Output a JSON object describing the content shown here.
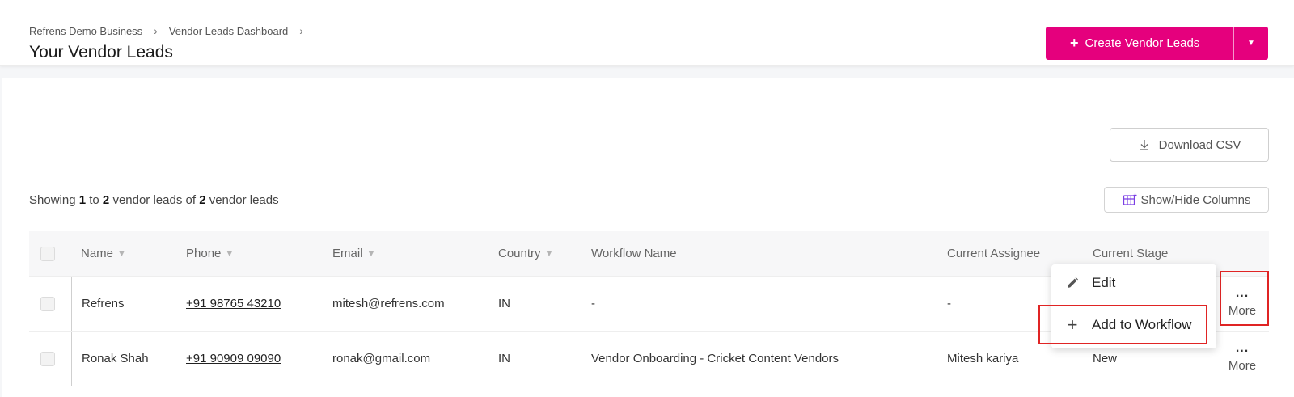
{
  "breadcrumb": [
    "Refrens Demo Business",
    "Vendor Leads Dashboard"
  ],
  "breadcrumb_sep": "›",
  "page_title": "Your Vendor Leads",
  "create_button": {
    "plus": "+",
    "label": "Create Vendor Leads",
    "caret": "▼"
  },
  "download_csv_label": "Download CSV",
  "showing": {
    "prefix": "Showing",
    "from": "1",
    "to_word": "to",
    "to": "2",
    "unit": "vendor leads",
    "of_word": "of",
    "total": "2",
    "suffix": "vendor leads"
  },
  "show_hide_label": "Show/Hide Columns",
  "columns": {
    "name": "Name",
    "phone": "Phone",
    "email": "Email",
    "country": "Country",
    "workflow": "Workflow Name",
    "assignee": "Current Assignee",
    "stage": "Current Stage"
  },
  "filter_glyph": "▼",
  "rows": [
    {
      "name": "Refrens",
      "phone": "+91 98765 43210",
      "email": "mitesh@refrens.com",
      "country": "IN",
      "workflow": "-",
      "assignee": "-",
      "stage": "",
      "more_dots": "...",
      "more_label": "More"
    },
    {
      "name": "Ronak Shah",
      "phone": "+91 90909 09090",
      "email": "ronak@gmail.com",
      "country": "IN",
      "workflow": "Vendor Onboarding - Cricket Content Vendors",
      "assignee": "Mitesh kariya",
      "stage": "New",
      "more_dots": "...",
      "more_label": "More"
    }
  ],
  "menu": {
    "edit_label": "Edit",
    "add_icon": "+",
    "add_label": "Add to Workflow"
  },
  "colors": {
    "brand": "#e5007d",
    "highlight": "#e02424",
    "icon_purple": "#7b3fe4"
  }
}
